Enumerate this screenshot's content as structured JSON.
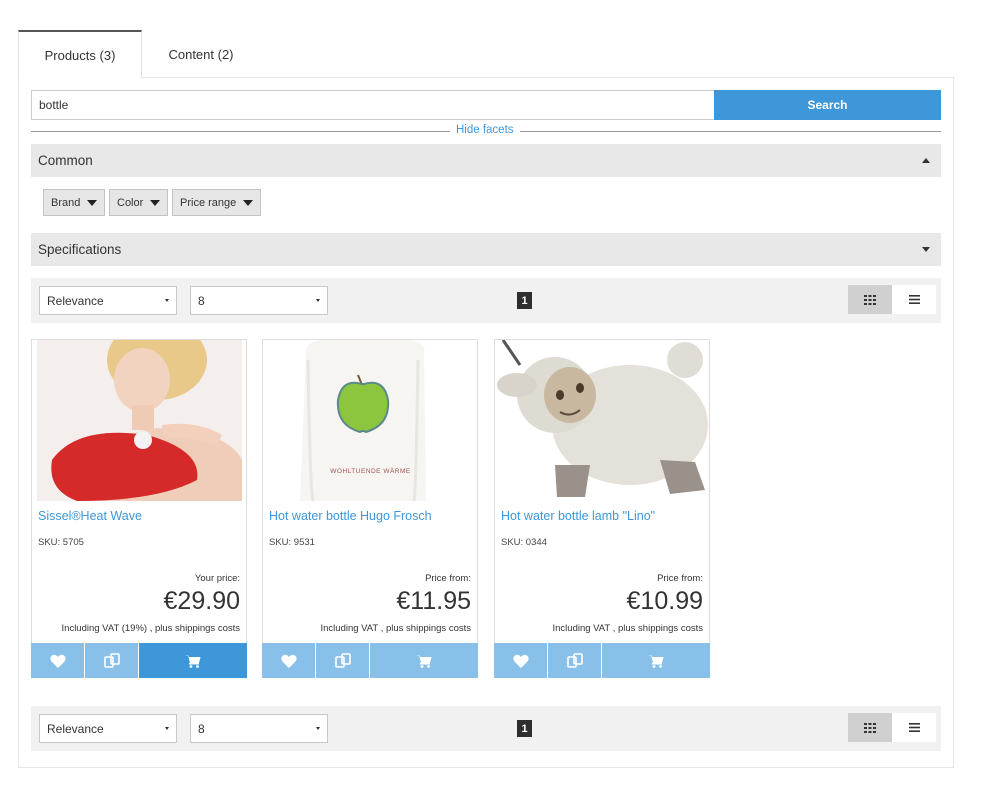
{
  "tabs": [
    {
      "label": "Products (3)",
      "active": true
    },
    {
      "label": "Content (2)",
      "active": false
    }
  ],
  "search": {
    "value": "bottle",
    "button_label": "Search"
  },
  "facets": {
    "toggle_label": "Hide facets",
    "groups": [
      {
        "title": "Common",
        "expanded": true,
        "buttons": [
          "Brand",
          "Color",
          "Price range"
        ]
      },
      {
        "title": "Specifications",
        "expanded": false
      }
    ]
  },
  "toolbar": {
    "sort_value": "Relevance",
    "per_page_value": "8",
    "current_page": "1"
  },
  "products": [
    {
      "name": "Sissel®Heat Wave",
      "sku": "SKU: 5705",
      "price_label": "Your price:",
      "price": "€29.90",
      "vat": "Including VAT (19%) , plus shippings costs"
    },
    {
      "name": "Hot water bottle Hugo Frosch",
      "sku": "SKU: 9531",
      "price_label": "Price from:",
      "price": "€11.95",
      "vat": "Including VAT , plus shippings costs",
      "image_text": "WOHLTUENDE WÄRME"
    },
    {
      "name": "Hot water bottle lamb \"Lino\"",
      "sku": "SKU: 0344",
      "price_label": "Price from:",
      "price": "€10.99",
      "vat": "Including VAT , plus shippings costs"
    }
  ],
  "colors": {
    "accent": "#3d97d9",
    "accent_light": "#89c0e9",
    "facet_bg": "#e8e8e8",
    "toolbar_bg": "#f1f1f1"
  }
}
